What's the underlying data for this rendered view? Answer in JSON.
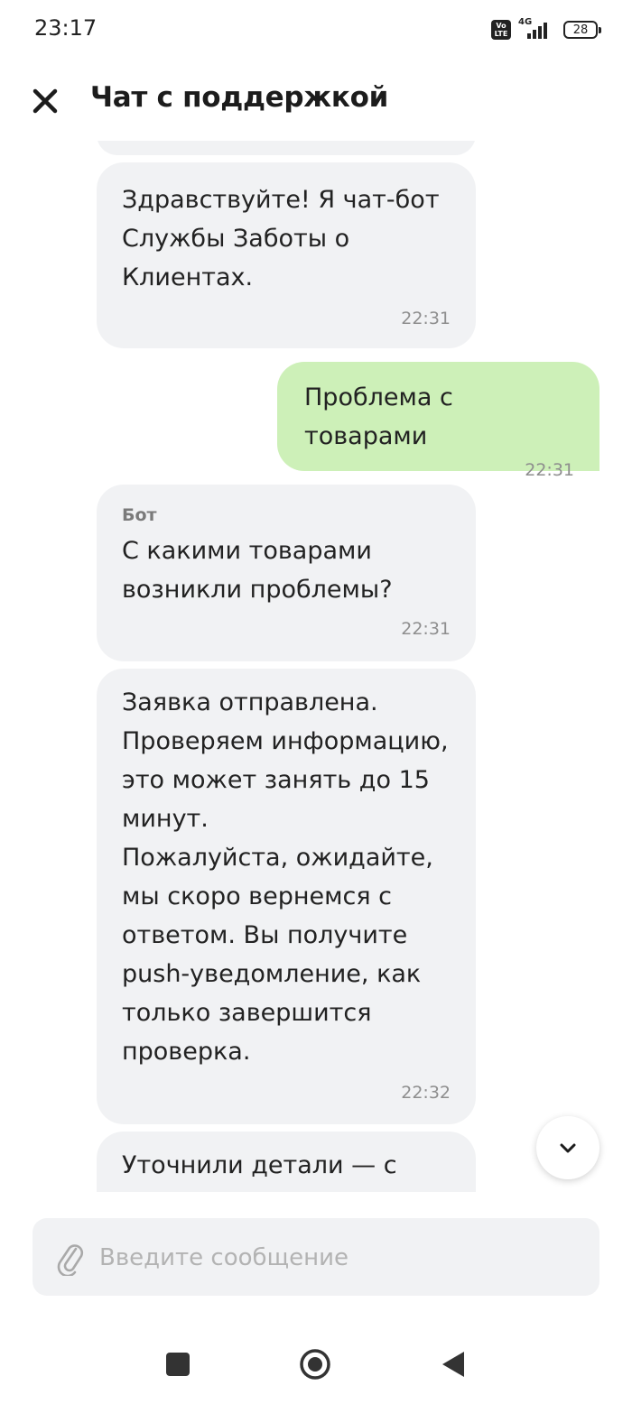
{
  "status_bar": {
    "time": "23:17",
    "network": "4G",
    "battery": "28",
    "volte_top": "Vo",
    "volte_bottom": "LTE"
  },
  "header": {
    "title": "Чат с поддержкой",
    "close_icon": "close-icon"
  },
  "messages": [
    {
      "from": "bot",
      "lines": [
        "Здравствуйте! Я чат-бот",
        "Службы Заботы о",
        "Клиентах."
      ],
      "time": "22:31"
    },
    {
      "from": "me",
      "lines": [
        "Проблема с товарами"
      ],
      "time": "22:31"
    },
    {
      "from": "bot",
      "sender": "Бот",
      "lines": [
        "С какими товарами",
        "возникли проблемы?"
      ],
      "time": "22:31"
    },
    {
      "from": "bot",
      "lines": [
        "Заявка отправлена.",
        "Проверяем информацию,",
        "это может занять до 15",
        "минут.",
        "Пожалуйста, ожидайте,",
        "мы скоро вернемся с",
        "ответом. Вы получите",
        "push-уведомление, как",
        "только завершится",
        "проверка."
      ],
      "time": "22:32"
    },
    {
      "from": "bot",
      "lines": [
        "Уточнили детали — с"
      ]
    }
  ],
  "composer": {
    "placeholder": "Введите сообщение",
    "value": ""
  },
  "colors": {
    "bot_bubble": "#f1f2f4",
    "user_bubble": "#cdf0b8",
    "input_bg": "#f1f2f4"
  }
}
